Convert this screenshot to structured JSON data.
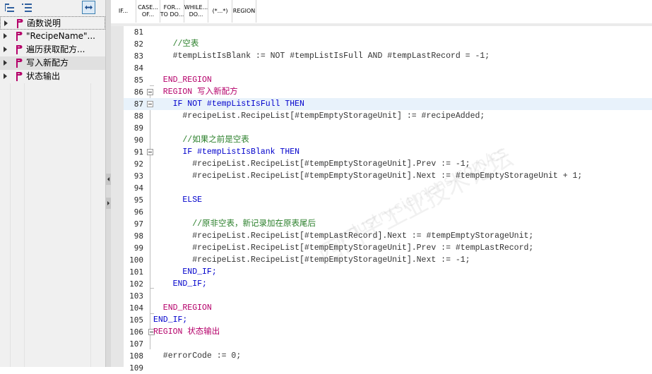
{
  "left_panel": {
    "toolbar": {
      "collapse_icon": "collapse-all-icon",
      "expand_icon": "expand-all-icon",
      "sync_icon": "synchronize-icon"
    },
    "tree": [
      {
        "label": "函数说明"
      },
      {
        "label": "\"RecipeName\"..."
      },
      {
        "label": "遍历获取配方..."
      },
      {
        "label": "写入新配方"
      },
      {
        "label": "状态输出"
      }
    ]
  },
  "toolbar": {
    "buttons": [
      {
        "line1": "IF...",
        "line2": ""
      },
      {
        "line1": "CASE...",
        "line2": "OF..."
      },
      {
        "line1": "FOR...",
        "line2": "TO DO..."
      },
      {
        "line1": "WHILE...",
        "line2": "DO..."
      },
      {
        "line1": "(*...*)",
        "line2": ""
      },
      {
        "line1": "REGION",
        "line2": ""
      }
    ]
  },
  "editor": {
    "current_line": "87",
    "lines": [
      {
        "n": "81",
        "text": ""
      },
      {
        "n": "82",
        "text": "    //空表"
      },
      {
        "n": "83",
        "text": "    #tempListIsBlank := NOT #tempListIsFull AND #tempLastRecord = -1;"
      },
      {
        "n": "84",
        "text": ""
      },
      {
        "n": "85",
        "text": "  END_REGION"
      },
      {
        "n": "86",
        "text": "  REGION 写入新配方"
      },
      {
        "n": "87",
        "text": "    IF NOT #tempListIsFull THEN"
      },
      {
        "n": "88",
        "text": "      #recipeList.RecipeList[#tempEmptyStorageUnit] := #recipeAdded;"
      },
      {
        "n": "89",
        "text": ""
      },
      {
        "n": "90",
        "text": "      //如果之前是空表"
      },
      {
        "n": "91",
        "text": "      IF #tempListIsBlank THEN"
      },
      {
        "n": "92",
        "text": "        #recipeList.RecipeList[#tempEmptyStorageUnit].Prev := -1;"
      },
      {
        "n": "93",
        "text": "        #recipeList.RecipeList[#tempEmptyStorageUnit].Next := #tempEmptyStorageUnit + 1;"
      },
      {
        "n": "94",
        "text": ""
      },
      {
        "n": "95",
        "text": "      ELSE"
      },
      {
        "n": "96",
        "text": ""
      },
      {
        "n": "97",
        "text": "        //原非空表，新记录加在原表尾后"
      },
      {
        "n": "98",
        "text": "        #recipeList.RecipeList[#tempLastRecord].Next := #tempEmptyStorageUnit;"
      },
      {
        "n": "99",
        "text": "        #recipeList.RecipeList[#tempEmptyStorageUnit].Prev := #tempLastRecord;"
      },
      {
        "n": "100",
        "text": "        #recipeList.RecipeList[#tempEmptyStorageUnit].Next := -1;"
      },
      {
        "n": "101",
        "text": "      END_IF;"
      },
      {
        "n": "102",
        "text": "    END_IF;"
      },
      {
        "n": "103",
        "text": ""
      },
      {
        "n": "104",
        "text": "  END_REGION"
      },
      {
        "n": "105",
        "text": "END_IF;"
      },
      {
        "n": "106",
        "text": "REGION 状态输出"
      },
      {
        "n": "107",
        "text": ""
      },
      {
        "n": "108",
        "text": "  #errorCode := 0;"
      },
      {
        "n": "109",
        "text": ""
      }
    ]
  },
  "watermark": {
    "text": "西门子工业技术论坛",
    "url": "industry.siemens.com/cs"
  },
  "colors": {
    "keyword": "#0000cc",
    "region": "#b5006a",
    "comment": "#2a7f2a",
    "current_line_bg": "#e8f2fb"
  }
}
